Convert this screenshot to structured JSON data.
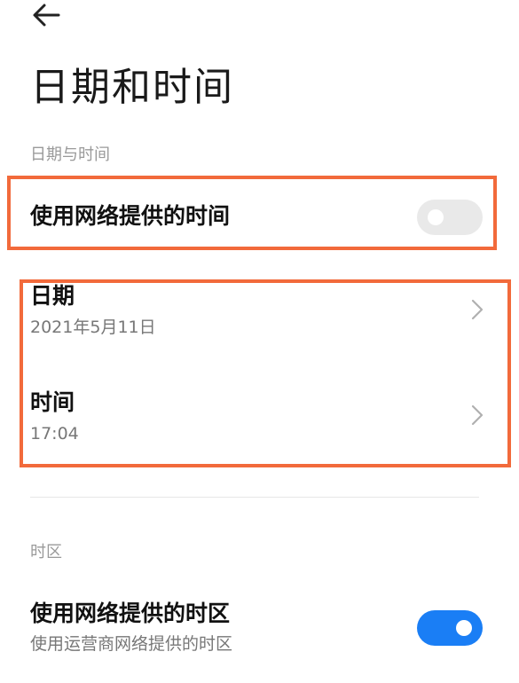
{
  "header": {
    "back_icon": "back-arrow-icon",
    "title": "日期和时间"
  },
  "date_time_section": {
    "header": "日期与时间",
    "network_time": {
      "label": "使用网络提供的时间",
      "enabled": false
    },
    "date": {
      "label": "日期",
      "value": "2021年5月11日"
    },
    "time": {
      "label": "时间",
      "value": "17:04"
    }
  },
  "timezone_section": {
    "header": "时区",
    "network_timezone": {
      "label": "使用网络提供的时区",
      "subtitle": "使用运营商网络提供的时区",
      "enabled": true
    }
  },
  "colors": {
    "highlight": "#f26a3b",
    "toggle_on": "#1a7ef5",
    "toggle_off": "#e9e9e9"
  }
}
